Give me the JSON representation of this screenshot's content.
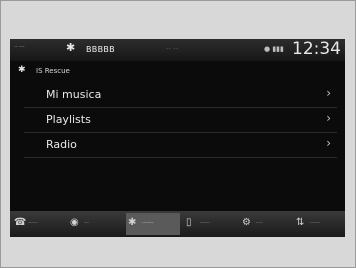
{
  "status": {
    "left_text": "-- ---",
    "device_name": "BBBBB",
    "center_text": "-- --",
    "signal_text": "● ▮▮▮",
    "time": "12:34"
  },
  "header": {
    "title": "IS Rescue"
  },
  "list": {
    "items": [
      {
        "label": "Mi musica"
      },
      {
        "label": "Playlists"
      },
      {
        "label": "Radio"
      }
    ]
  },
  "dock": {
    "items": [
      {
        "label": "------",
        "icon": "phone-icon"
      },
      {
        "label": "---",
        "icon": "mic-icon"
      },
      {
        "label": "-------",
        "icon": "bluetooth-audio-icon",
        "active": true
      },
      {
        "label": "------",
        "icon": "phone-device-icon"
      },
      {
        "label": "----",
        "icon": "settings-icon"
      },
      {
        "label": "------",
        "icon": "sort-icon"
      }
    ]
  },
  "icons": {
    "bluetooth": "ʙ",
    "chevron": "›"
  }
}
